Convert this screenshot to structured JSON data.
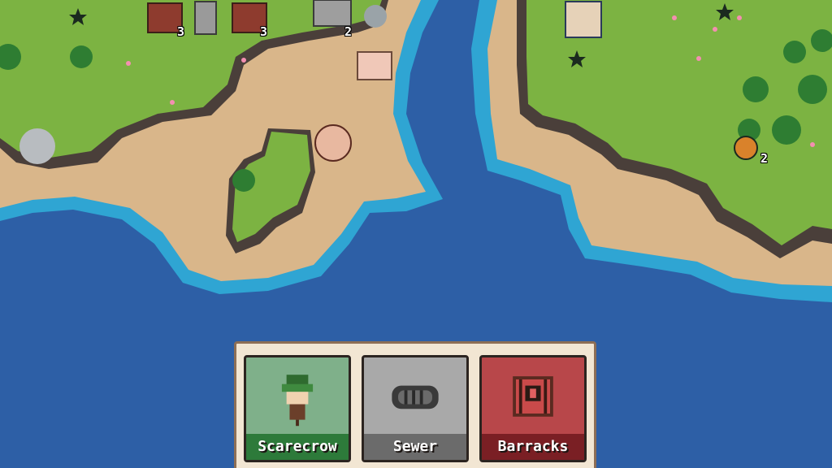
{
  "map": {
    "counts": {
      "crate_left": "3",
      "crate_right": "3",
      "gate": "2",
      "bush": "2"
    }
  },
  "build_bar": {
    "cards": {
      "scarecrow": {
        "label": "Scarecrow",
        "icon": "scarecrow-icon"
      },
      "sewer": {
        "label": "Sewer",
        "icon": "sewer-grate-icon"
      },
      "barracks": {
        "label": "Barracks",
        "icon": "barracks-icon"
      }
    }
  },
  "colors": {
    "deep_water": "#2d5fa6",
    "shallow_water": "#2fa5d3",
    "sand": "#d9b68a",
    "grass": "#7cb342",
    "cliff": "#4a3f3a",
    "panel": "#f2e6d3",
    "scarecrow_card": "#2d7a3a",
    "sewer_card": "#6b6b6b",
    "barracks_card": "#7a1f24"
  }
}
